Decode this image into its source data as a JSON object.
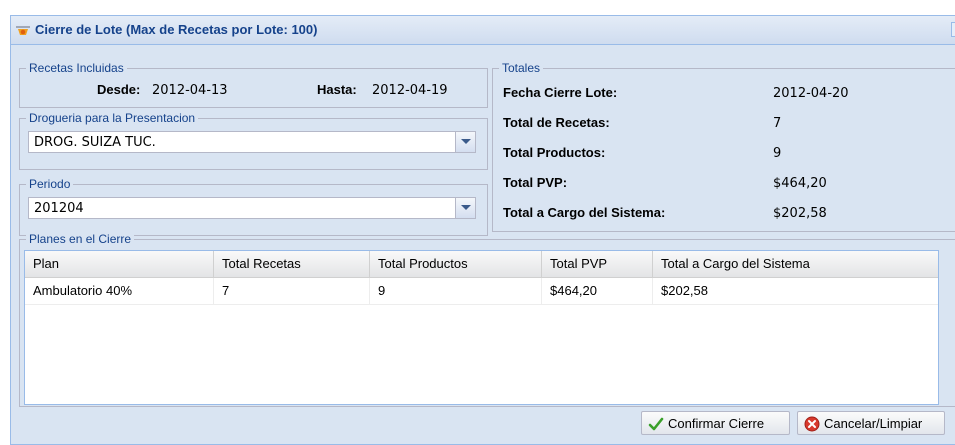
{
  "window": {
    "title": "Cierre de Lote (Max de Recetas por Lote: 100)",
    "close_label": "×"
  },
  "recetas": {
    "legend": "Recetas Incluidas",
    "desde_label": "Desde:",
    "desde_value": "2012-04-13",
    "hasta_label": "Hasta:",
    "hasta_value": "2012-04-19"
  },
  "drogueria": {
    "legend": "Drogueria para la Presentacion",
    "value": "DROG. SUIZA TUC."
  },
  "periodo": {
    "legend": "Periodo",
    "value": "201204"
  },
  "totales": {
    "legend": "Totales",
    "rows": [
      {
        "label": "Fecha Cierre Lote:",
        "value": "2012-04-20"
      },
      {
        "label": "Total de Recetas:",
        "value": "7"
      },
      {
        "label": "Total Productos:",
        "value": "9"
      },
      {
        "label": "Total PVP:",
        "value": "$464,20"
      },
      {
        "label": "Total a Cargo del Sistema:",
        "value": "$202,58"
      }
    ]
  },
  "planes": {
    "legend": "Planes en el Cierre",
    "columns": [
      "Plan",
      "Total Recetas",
      "Total Productos",
      "Total PVP",
      "Total a Cargo del Sistema"
    ],
    "rows": [
      [
        "Ambulatorio 40%",
        "7",
        "9",
        "$464,20",
        "$202,58"
      ]
    ]
  },
  "buttons": {
    "confirmar": "Confirmar Cierre",
    "cancelar": "Cancelar/Limpiar"
  },
  "icons": {
    "title": "window-icon",
    "confirm": "check-icon",
    "cancel": "cancel-icon"
  },
  "colors": {
    "panel_bg": "#d9e4f2",
    "title_text": "#15428b",
    "border": "#99bbe8"
  }
}
